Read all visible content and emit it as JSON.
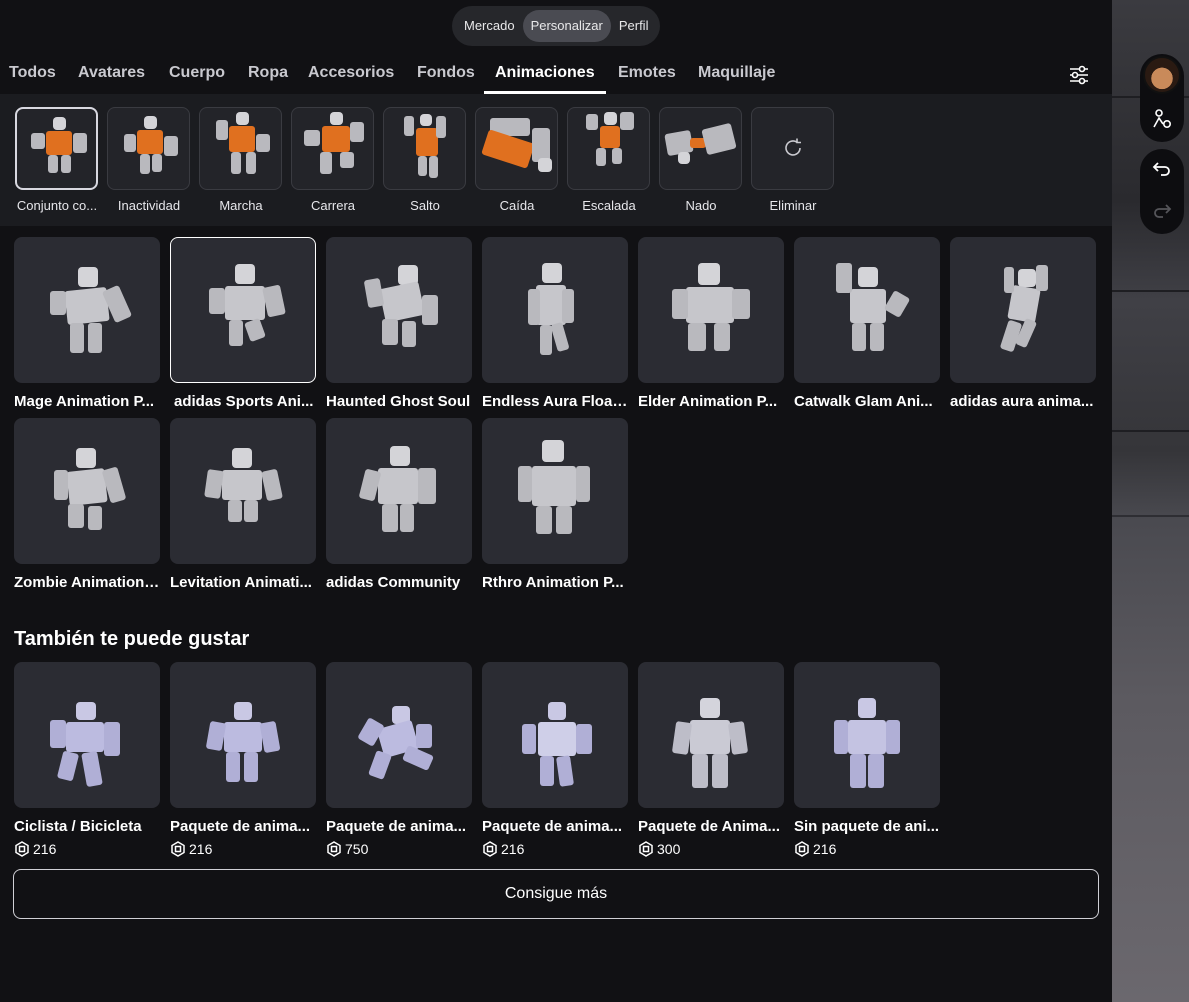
{
  "top_nav": {
    "items": [
      "Mercado",
      "Personalizar",
      "Perfil"
    ],
    "active": "Personalizar"
  },
  "tabs": {
    "items": [
      "Todos",
      "Avatares",
      "Cuerpo",
      "Ropa",
      "Accesorios",
      "Fondos",
      "Animaciones",
      "Emotes",
      "Maquillaje"
    ],
    "active": "Animaciones",
    "filter_icon": "filter-icon"
  },
  "slots": {
    "items": [
      "Conjunto co...",
      "Inactividad",
      "Marcha",
      "Carrera",
      "Salto",
      "Caída",
      "Escalada",
      "Nado",
      "Eliminar"
    ],
    "selected": "Conjunto co...",
    "remove_icon": "refresh-icon"
  },
  "owned": [
    {
      "name": "Mage Animation P..."
    },
    {
      "name": "adidas Sports Ani...",
      "selected": true
    },
    {
      "name": "Haunted Ghost Soul"
    },
    {
      "name": "Endless Aura Float..."
    },
    {
      "name": "Elder Animation P..."
    },
    {
      "name": "Catwalk Glam Ani..."
    },
    {
      "name": "adidas aura anima..."
    },
    {
      "name": "Zombie Animation ..."
    },
    {
      "name": "Levitation Animati..."
    },
    {
      "name": "adidas Community"
    },
    {
      "name": "Rthro Animation P..."
    }
  ],
  "recommended": {
    "title": "También te puede gustar",
    "items": [
      {
        "name": "Ciclista / Bicicleta",
        "price": "216"
      },
      {
        "name": "Paquete de anima...",
        "price": "216"
      },
      {
        "name": "Paquete de anima...",
        "price": "750"
      },
      {
        "name": "Paquete de anima...",
        "price": "216"
      },
      {
        "name": "Paquete de Anima...",
        "price": "300"
      },
      {
        "name": "Sin paquete de ani...",
        "price": "216"
      }
    ],
    "currency_icon": "robux-icon"
  },
  "more_button": "Consigue más",
  "side_controls": {
    "icons": [
      "avatar-thumbnail",
      "avatar-settings-icon",
      "undo-icon",
      "redo-icon"
    ]
  },
  "colors": {
    "background": "#111114",
    "card": "#2b2c33",
    "accent_orange": "#e0701f"
  }
}
